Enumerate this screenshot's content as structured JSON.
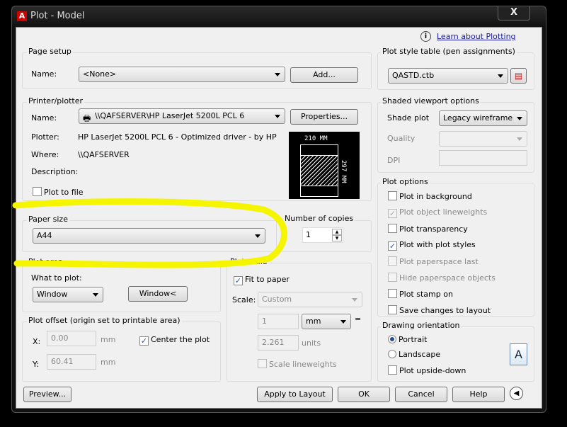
{
  "window": {
    "title": "Plot - Model",
    "close": "X"
  },
  "help": {
    "link": "Learn about Plotting"
  },
  "page_setup": {
    "label": "Page setup",
    "name_label": "Name:",
    "name_value": "<None>",
    "add_button": "Add..."
  },
  "printer": {
    "label": "Printer/plotter",
    "name_label": "Name:",
    "name_value": "\\\\QAFSERVER\\HP LaserJet 5200L PCL 6",
    "properties_button": "Properties...",
    "plotter_label": "Plotter:",
    "plotter_value": "HP LaserJet 5200L PCL 6 - Optimized driver - by HP",
    "where_label": "Where:",
    "where_value": "\\\\QAFSERVER",
    "description_label": "Description:",
    "plot_to_file": "Plot to file",
    "preview_width": "210 MM",
    "preview_height": "297 MM"
  },
  "paper_size": {
    "label": "Paper size",
    "value": "A44"
  },
  "copies": {
    "label": "Number of copies",
    "value": "1"
  },
  "plot_area": {
    "label": "Plot area",
    "what_label": "What to plot:",
    "what_value": "Window",
    "window_button": "Window<"
  },
  "plot_offset": {
    "label": "Plot offset (origin set to printable area)",
    "x_label": "X:",
    "x_value": "0.00",
    "y_label": "Y:",
    "y_value": "60.41",
    "unit": "mm",
    "center": "Center the plot"
  },
  "plot_scale": {
    "label": "Plot scale",
    "fit": "Fit to paper",
    "scale_label": "Scale:",
    "scale_value": "Custom",
    "val1": "1",
    "unit1": "mm",
    "equals": "=",
    "val2": "2.261",
    "unit2": "units",
    "lineweights": "Scale lineweights"
  },
  "plot_style": {
    "label": "Plot style table (pen assignments)",
    "value": "QASTD.ctb"
  },
  "shaded": {
    "label": "Shaded viewport options",
    "shade_label": "Shade plot",
    "shade_value": "Legacy wireframe",
    "quality_label": "Quality",
    "dpi_label": "DPI"
  },
  "plot_options": {
    "label": "Plot options",
    "items": [
      {
        "label": "Plot in background",
        "checked": false,
        "enabled": true
      },
      {
        "label": "Plot object lineweights",
        "checked": true,
        "enabled": false
      },
      {
        "label": "Plot transparency",
        "checked": false,
        "enabled": true
      },
      {
        "label": "Plot with plot styles",
        "checked": true,
        "enabled": true
      },
      {
        "label": "Plot paperspace last",
        "checked": false,
        "enabled": false
      },
      {
        "label": "Hide paperspace objects",
        "checked": false,
        "enabled": false
      },
      {
        "label": "Plot stamp on",
        "checked": false,
        "enabled": true
      },
      {
        "label": "Save changes to layout",
        "checked": false,
        "enabled": true
      }
    ]
  },
  "orientation": {
    "label": "Drawing orientation",
    "portrait": "Portrait",
    "landscape": "Landscape",
    "upside_down": "Plot upside-down",
    "selected": "Portrait",
    "icon_letter": "A"
  },
  "footer": {
    "preview": "Preview...",
    "apply": "Apply to Layout",
    "ok": "OK",
    "cancel": "Cancel",
    "help": "Help"
  },
  "annotation_color": "#f5f500"
}
